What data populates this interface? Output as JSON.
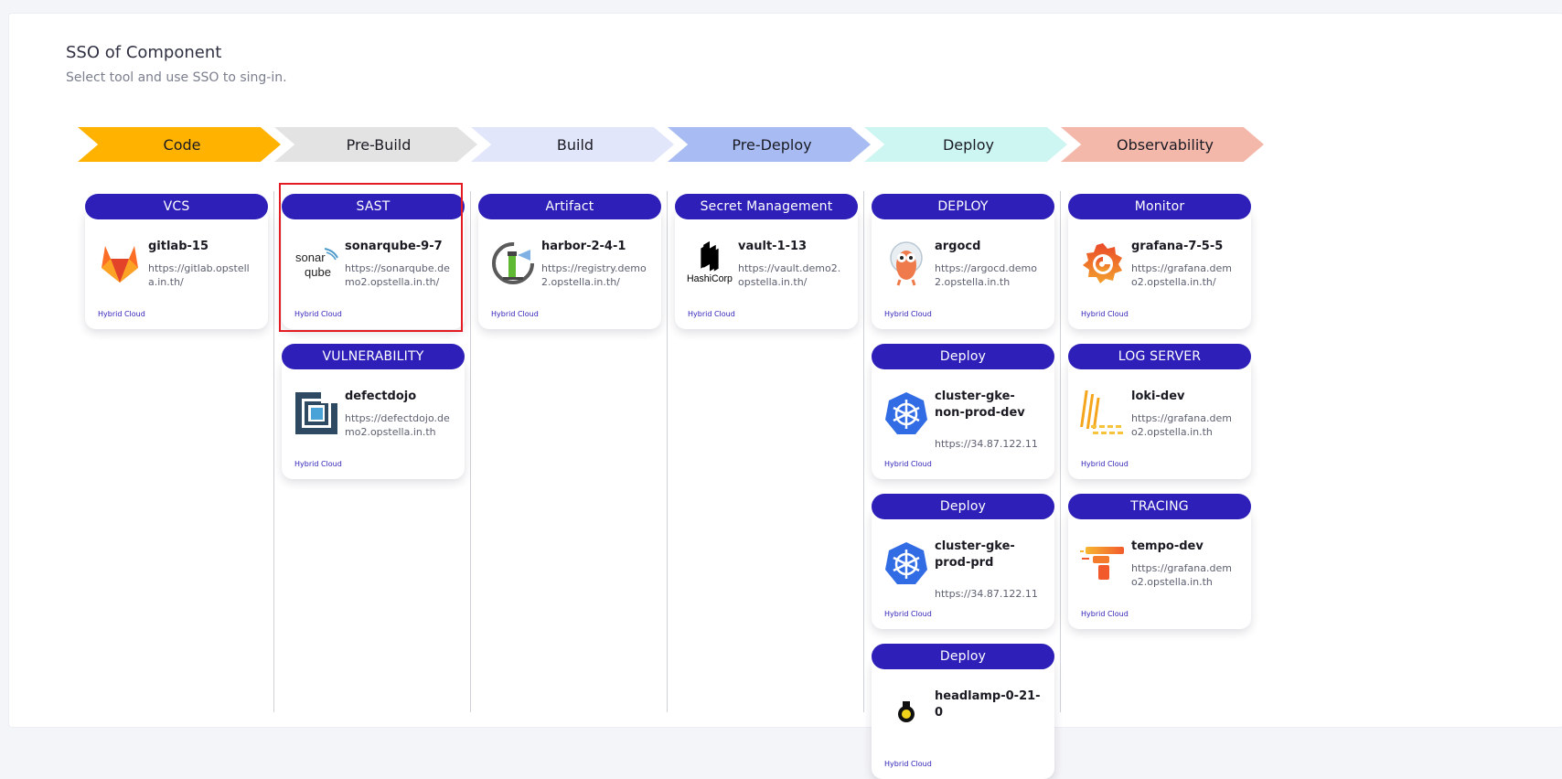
{
  "page": {
    "title": "SSO of Component",
    "subtitle": "Select tool and use SSO to sing-in."
  },
  "stages": [
    {
      "label": "Code",
      "color": "#ffb300"
    },
    {
      "label": "Pre-Build",
      "color": "#e3e3e3"
    },
    {
      "label": "Build",
      "color": "#e2e6fa"
    },
    {
      "label": "Pre-Deploy",
      "color": "#a8bcf3"
    },
    {
      "label": "Deploy",
      "color": "#cdf6f2"
    },
    {
      "label": "Observability",
      "color": "#f4b8ab"
    }
  ],
  "tag_label": "Hybrid Cloud",
  "colors": {
    "accent": "#2d1fb7",
    "selection": "#e51b23"
  },
  "columns": [
    {
      "cards": [
        {
          "category": "VCS",
          "name": "gitlab-15",
          "url": "https://gitlab.opstella.in.th/",
          "icon": "gitlab-icon"
        }
      ]
    },
    {
      "cards": [
        {
          "category": "SAST",
          "name": "sonarqube-9-7",
          "url": "https://sonarqube.demo2.opstella.in.th/",
          "icon": "sonarqube-icon",
          "selected": true
        },
        {
          "category": "VULNERABILITY",
          "name": "defectdojo",
          "url": "https://defectdojo.demo2.opstella.in.th",
          "icon": "defectdojo-icon"
        }
      ]
    },
    {
      "cards": [
        {
          "category": "Artifact",
          "name": "harbor-2-4-1",
          "url": "https://registry.demo2.opstella.in.th/",
          "icon": "harbor-icon"
        }
      ]
    },
    {
      "cards": [
        {
          "category": "Secret Management",
          "name": "vault-1-13",
          "url": "https://vault.demo2.opstella.in.th/",
          "icon": "hashicorp-icon"
        }
      ]
    },
    {
      "cards": [
        {
          "category": "DEPLOY",
          "name": "argocd",
          "url": "https://argocd.demo2.opstella.in.th",
          "icon": "argocd-icon"
        },
        {
          "category": "Deploy",
          "name": "cluster-gke-non-prod-dev",
          "url": "https://34.87.122.11",
          "icon": "kubernetes-icon"
        },
        {
          "category": "Deploy",
          "name": "cluster-gke-prod-prd",
          "url": "https://34.87.122.11",
          "icon": "kubernetes-icon"
        },
        {
          "category": "Deploy",
          "name": "headlamp-0-21-0",
          "url": "",
          "icon": "headlamp-icon"
        }
      ]
    },
    {
      "cards": [
        {
          "category": "Monitor",
          "name": "grafana-7-5-5",
          "url": "https://grafana.demo2.opstella.in.th/",
          "icon": "grafana-icon"
        },
        {
          "category": "LOG SERVER",
          "name": "loki-dev",
          "url": "https://grafana.demo2.opstella.in.th",
          "icon": "loki-icon"
        },
        {
          "category": "TRACING",
          "name": "tempo-dev",
          "url": "https://grafana.demo2.opstella.in.th",
          "icon": "tempo-icon"
        }
      ]
    }
  ]
}
